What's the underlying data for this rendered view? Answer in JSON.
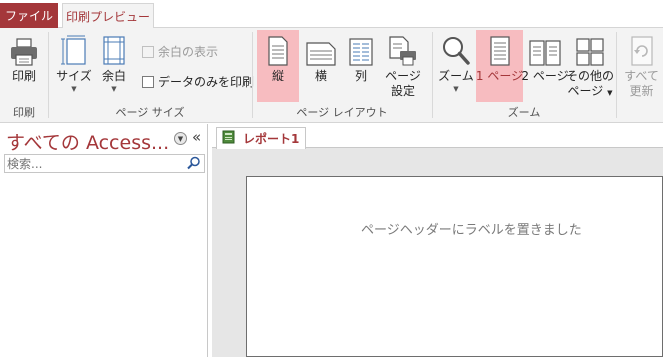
{
  "tabs": {
    "file": "ファイル",
    "print_preview": "印刷プレビュー"
  },
  "ribbon": {
    "print_group": {
      "label": "印刷",
      "print_button": "印刷"
    },
    "page_size_group": {
      "label": "ページ サイズ",
      "size_button": "サイズ",
      "margins_button": "余白",
      "show_margins": "余白の表示",
      "print_data_only": "データのみを印刷"
    },
    "page_layout_group": {
      "label": "ページ レイアウト",
      "portrait": "縦",
      "landscape": "横",
      "columns": "列",
      "page_setup_line1": "ページ",
      "page_setup_line2": "設定"
    },
    "zoom_group": {
      "label": "ズーム",
      "zoom": "ズーム",
      "one_page": "1 ページ",
      "two_pages": "2 ページ",
      "more_pages_line1": "その他の",
      "more_pages_line2": "ページ"
    },
    "refresh": {
      "line1": "すべて",
      "line2": "更新"
    }
  },
  "nav": {
    "title": "すべての Access...",
    "search_placeholder": "検索..."
  },
  "document": {
    "tab_label": "レポート1",
    "page_header_label": "ページヘッダーにラベルを置きました"
  },
  "colors": {
    "accent": "#a4373a",
    "active_button": "#f7bcc0",
    "ribbon_bg": "#f3f3f3"
  }
}
